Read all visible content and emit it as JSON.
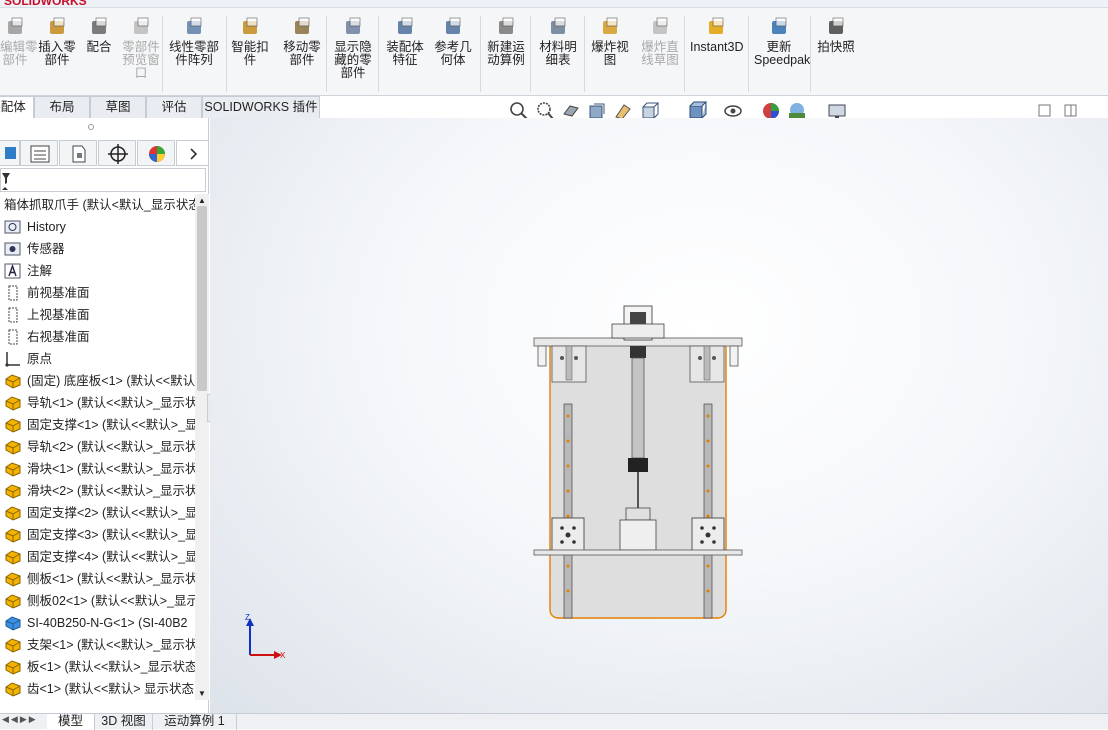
{
  "app": {
    "logo_text": "SOLIDWORKS"
  },
  "ribbon": {
    "buttons": [
      {
        "label": "编辑零\n部件",
        "disabled": true
      },
      {
        "label": "插入零\n部件",
        "disabled": false
      },
      {
        "label": "配合",
        "disabled": false
      },
      {
        "label": "零部件\n预览窗\n口",
        "disabled": true
      },
      {
        "label": "线性零部\n件阵列",
        "disabled": false
      },
      {
        "label": "智能扣\n件",
        "disabled": false
      },
      {
        "label": "移动零\n部件",
        "disabled": false
      },
      {
        "label": "显示隐\n藏的零\n部件",
        "disabled": false
      },
      {
        "label": "装配体\n特征",
        "disabled": false
      },
      {
        "label": "参考几\n何体",
        "disabled": false
      },
      {
        "label": "新建运\n动算例",
        "disabled": false
      },
      {
        "label": "材料明\n细表",
        "disabled": false
      },
      {
        "label": "爆炸视\n图",
        "disabled": false
      },
      {
        "label": "爆炸直\n线草图",
        "disabled": true
      },
      {
        "label": "Instant3D",
        "disabled": false
      },
      {
        "label": "更新\nSpeedpak",
        "disabled": false
      },
      {
        "label": "拍快照",
        "disabled": false
      }
    ]
  },
  "tabs": [
    "装配体",
    "布局",
    "草图",
    "评估",
    "SOLIDWORKS 插件"
  ],
  "tree": {
    "root": "箱体抓取爪手 (默认<默认_显示状态",
    "items": [
      {
        "label": "History",
        "icon": "history-icon"
      },
      {
        "label": "传感器",
        "icon": "sensor-icon"
      },
      {
        "label": "注解",
        "icon": "annotation-icon"
      },
      {
        "label": "前视基准面",
        "icon": "plane-icon"
      },
      {
        "label": "上视基准面",
        "icon": "plane-icon"
      },
      {
        "label": "右视基准面",
        "icon": "plane-icon"
      },
      {
        "label": "原点",
        "icon": "origin-icon"
      },
      {
        "label": "(固定) 底座板<1> (默认<<默认",
        "icon": "part-icon"
      },
      {
        "label": "导轨<1> (默认<<默认>_显示状",
        "icon": "part-icon"
      },
      {
        "label": "固定支撑<1> (默认<<默认>_显",
        "icon": "part-icon"
      },
      {
        "label": "导轨<2> (默认<<默认>_显示状",
        "icon": "part-icon"
      },
      {
        "label": "滑块<1> (默认<<默认>_显示状",
        "icon": "part-icon"
      },
      {
        "label": "滑块<2> (默认<<默认>_显示状",
        "icon": "part-icon"
      },
      {
        "label": "固定支撑<2> (默认<<默认>_显",
        "icon": "part-icon"
      },
      {
        "label": "固定支撑<3> (默认<<默认>_显",
        "icon": "part-icon"
      },
      {
        "label": "固定支撑<4> (默认<<默认>_显",
        "icon": "part-icon"
      },
      {
        "label": "侧板<1> (默认<<默认>_显示状",
        "icon": "part-icon"
      },
      {
        "label": "侧板02<1> (默认<<默认>_显示",
        "icon": "part-icon"
      },
      {
        "label": "SI-40B250-N-G<1> (SI-40B2",
        "icon": "assembly-icon"
      },
      {
        "label": "支架<1> (默认<<默认>_显示状",
        "icon": "part-icon"
      },
      {
        "label": "板<1> (默认<<默认>_显示状态",
        "icon": "part-icon"
      },
      {
        "label": "齿<1> (默认<<默认> 显示状态",
        "icon": "part-icon"
      }
    ]
  },
  "triad": {
    "z": "Z",
    "x": "X"
  },
  "bottom_tabs": [
    "模型",
    "3D 视图",
    "运动算例 1"
  ],
  "colors": {
    "accent": "#e67e00",
    "part_icon": "#f2b400",
    "axis_x": "#d01010",
    "axis_z": "#1030c0"
  }
}
